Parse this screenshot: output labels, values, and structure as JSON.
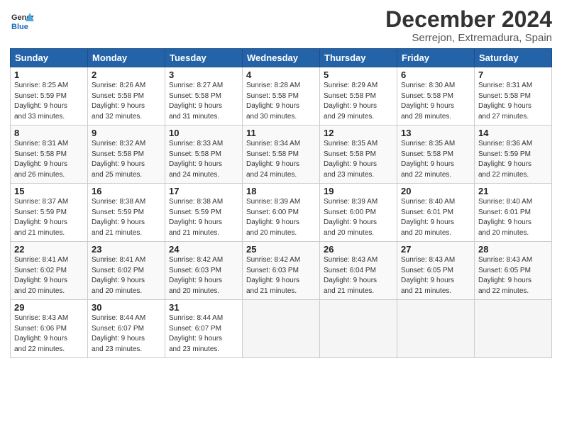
{
  "logo": {
    "line1": "General",
    "line2": "Blue"
  },
  "title": "December 2024",
  "location": "Serrejon, Extremadura, Spain",
  "weekdays": [
    "Sunday",
    "Monday",
    "Tuesday",
    "Wednesday",
    "Thursday",
    "Friday",
    "Saturday"
  ],
  "weeks": [
    [
      {
        "day": "1",
        "rise": "8:25 AM",
        "set": "5:59 PM",
        "hours": "9 hours",
        "mins": "33 minutes"
      },
      {
        "day": "2",
        "rise": "8:26 AM",
        "set": "5:58 PM",
        "hours": "9 hours",
        "mins": "32 minutes"
      },
      {
        "day": "3",
        "rise": "8:27 AM",
        "set": "5:58 PM",
        "hours": "9 hours",
        "mins": "31 minutes"
      },
      {
        "day": "4",
        "rise": "8:28 AM",
        "set": "5:58 PM",
        "hours": "9 hours",
        "mins": "30 minutes"
      },
      {
        "day": "5",
        "rise": "8:29 AM",
        "set": "5:58 PM",
        "hours": "9 hours",
        "mins": "29 minutes"
      },
      {
        "day": "6",
        "rise": "8:30 AM",
        "set": "5:58 PM",
        "hours": "9 hours",
        "mins": "28 minutes"
      },
      {
        "day": "7",
        "rise": "8:31 AM",
        "set": "5:58 PM",
        "hours": "9 hours",
        "mins": "27 minutes"
      }
    ],
    [
      {
        "day": "8",
        "rise": "8:31 AM",
        "set": "5:58 PM",
        "hours": "9 hours",
        "mins": "26 minutes"
      },
      {
        "day": "9",
        "rise": "8:32 AM",
        "set": "5:58 PM",
        "hours": "9 hours",
        "mins": "25 minutes"
      },
      {
        "day": "10",
        "rise": "8:33 AM",
        "set": "5:58 PM",
        "hours": "9 hours",
        "mins": "24 minutes"
      },
      {
        "day": "11",
        "rise": "8:34 AM",
        "set": "5:58 PM",
        "hours": "9 hours",
        "mins": "24 minutes"
      },
      {
        "day": "12",
        "rise": "8:35 AM",
        "set": "5:58 PM",
        "hours": "9 hours",
        "mins": "23 minutes"
      },
      {
        "day": "13",
        "rise": "8:35 AM",
        "set": "5:58 PM",
        "hours": "9 hours",
        "mins": "22 minutes"
      },
      {
        "day": "14",
        "rise": "8:36 AM",
        "set": "5:59 PM",
        "hours": "9 hours",
        "mins": "22 minutes"
      }
    ],
    [
      {
        "day": "15",
        "rise": "8:37 AM",
        "set": "5:59 PM",
        "hours": "9 hours",
        "mins": "21 minutes"
      },
      {
        "day": "16",
        "rise": "8:38 AM",
        "set": "5:59 PM",
        "hours": "9 hours",
        "mins": "21 minutes"
      },
      {
        "day": "17",
        "rise": "8:38 AM",
        "set": "5:59 PM",
        "hours": "9 hours",
        "mins": "21 minutes"
      },
      {
        "day": "18",
        "rise": "8:39 AM",
        "set": "6:00 PM",
        "hours": "9 hours",
        "mins": "20 minutes"
      },
      {
        "day": "19",
        "rise": "8:39 AM",
        "set": "6:00 PM",
        "hours": "9 hours",
        "mins": "20 minutes"
      },
      {
        "day": "20",
        "rise": "8:40 AM",
        "set": "6:01 PM",
        "hours": "9 hours",
        "mins": "20 minutes"
      },
      {
        "day": "21",
        "rise": "8:40 AM",
        "set": "6:01 PM",
        "hours": "9 hours",
        "mins": "20 minutes"
      }
    ],
    [
      {
        "day": "22",
        "rise": "8:41 AM",
        "set": "6:02 PM",
        "hours": "9 hours",
        "mins": "20 minutes"
      },
      {
        "day": "23",
        "rise": "8:41 AM",
        "set": "6:02 PM",
        "hours": "9 hours",
        "mins": "20 minutes"
      },
      {
        "day": "24",
        "rise": "8:42 AM",
        "set": "6:03 PM",
        "hours": "9 hours",
        "mins": "20 minutes"
      },
      {
        "day": "25",
        "rise": "8:42 AM",
        "set": "6:03 PM",
        "hours": "9 hours",
        "mins": "21 minutes"
      },
      {
        "day": "26",
        "rise": "8:43 AM",
        "set": "6:04 PM",
        "hours": "9 hours",
        "mins": "21 minutes"
      },
      {
        "day": "27",
        "rise": "8:43 AM",
        "set": "6:05 PM",
        "hours": "9 hours",
        "mins": "21 minutes"
      },
      {
        "day": "28",
        "rise": "8:43 AM",
        "set": "6:05 PM",
        "hours": "9 hours",
        "mins": "22 minutes"
      }
    ],
    [
      {
        "day": "29",
        "rise": "8:43 AM",
        "set": "6:06 PM",
        "hours": "9 hours",
        "mins": "22 minutes"
      },
      {
        "day": "30",
        "rise": "8:44 AM",
        "set": "6:07 PM",
        "hours": "9 hours",
        "mins": "23 minutes"
      },
      {
        "day": "31",
        "rise": "8:44 AM",
        "set": "6:07 PM",
        "hours": "9 hours",
        "mins": "23 minutes"
      },
      null,
      null,
      null,
      null
    ]
  ]
}
